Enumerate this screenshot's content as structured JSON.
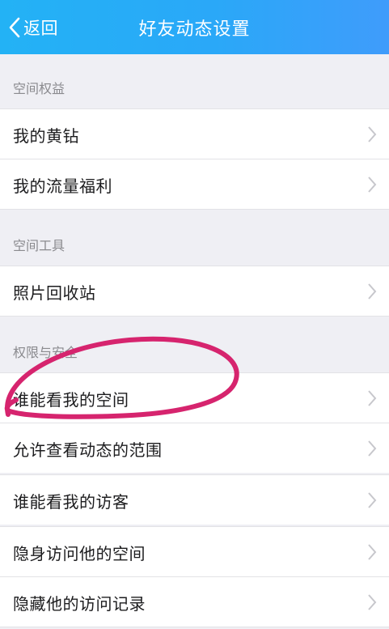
{
  "header": {
    "back_label": "返回",
    "title": "好友动态设置",
    "gradient": [
      "#23b2f5",
      "#3f9cfb"
    ]
  },
  "sections": [
    {
      "title": "空间权益",
      "items": [
        {
          "label": "我的黄钻"
        },
        {
          "label": "我的流量福利"
        }
      ]
    },
    {
      "title": "空间工具",
      "items": [
        {
          "label": "照片回收站"
        }
      ]
    },
    {
      "title": "权限与安全",
      "items": [
        {
          "label": "谁能看我的空间"
        },
        {
          "label": "允许查看动态的范围"
        },
        {
          "label": "谁能看我的访客"
        },
        {
          "label": "隐身访问他的空间"
        },
        {
          "label": "隐藏他的访问记录"
        }
      ]
    }
  ],
  "annotation": {
    "color": "#d6246e"
  }
}
